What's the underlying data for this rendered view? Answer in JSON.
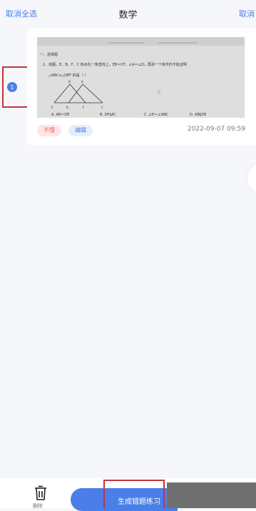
{
  "header": {
    "cancel_all_label": "取消全选",
    "title": "数学",
    "cancel_label": "取消"
  },
  "item": {
    "index": "1",
    "tags": {
      "wrong": "不懂",
      "edit": "编辑"
    },
    "timestamp": "2022-09-07 09:59",
    "thumbnail_text": {
      "section": "一、选择题",
      "q1": "1、如图，E、B、F、C 四点在一条直线上，EB＝CF，∠A＝∠D，再添一个条件仍不能证明",
      "q1b": "△ABC≌△DEF 的是（ ）",
      "optA": "A. AB＝DE",
      "optB": "B. DF∥AC",
      "optC": "C. ∠E＝∠ABC",
      "optD": "D. AB∥DE"
    }
  },
  "footer": {
    "delete_label": "删除",
    "generate_label": "生成错题练习"
  },
  "colors": {
    "accent": "#4a7ee8",
    "wrong_tag": "#e46a6a",
    "highlight_frame": "#c0343f"
  }
}
